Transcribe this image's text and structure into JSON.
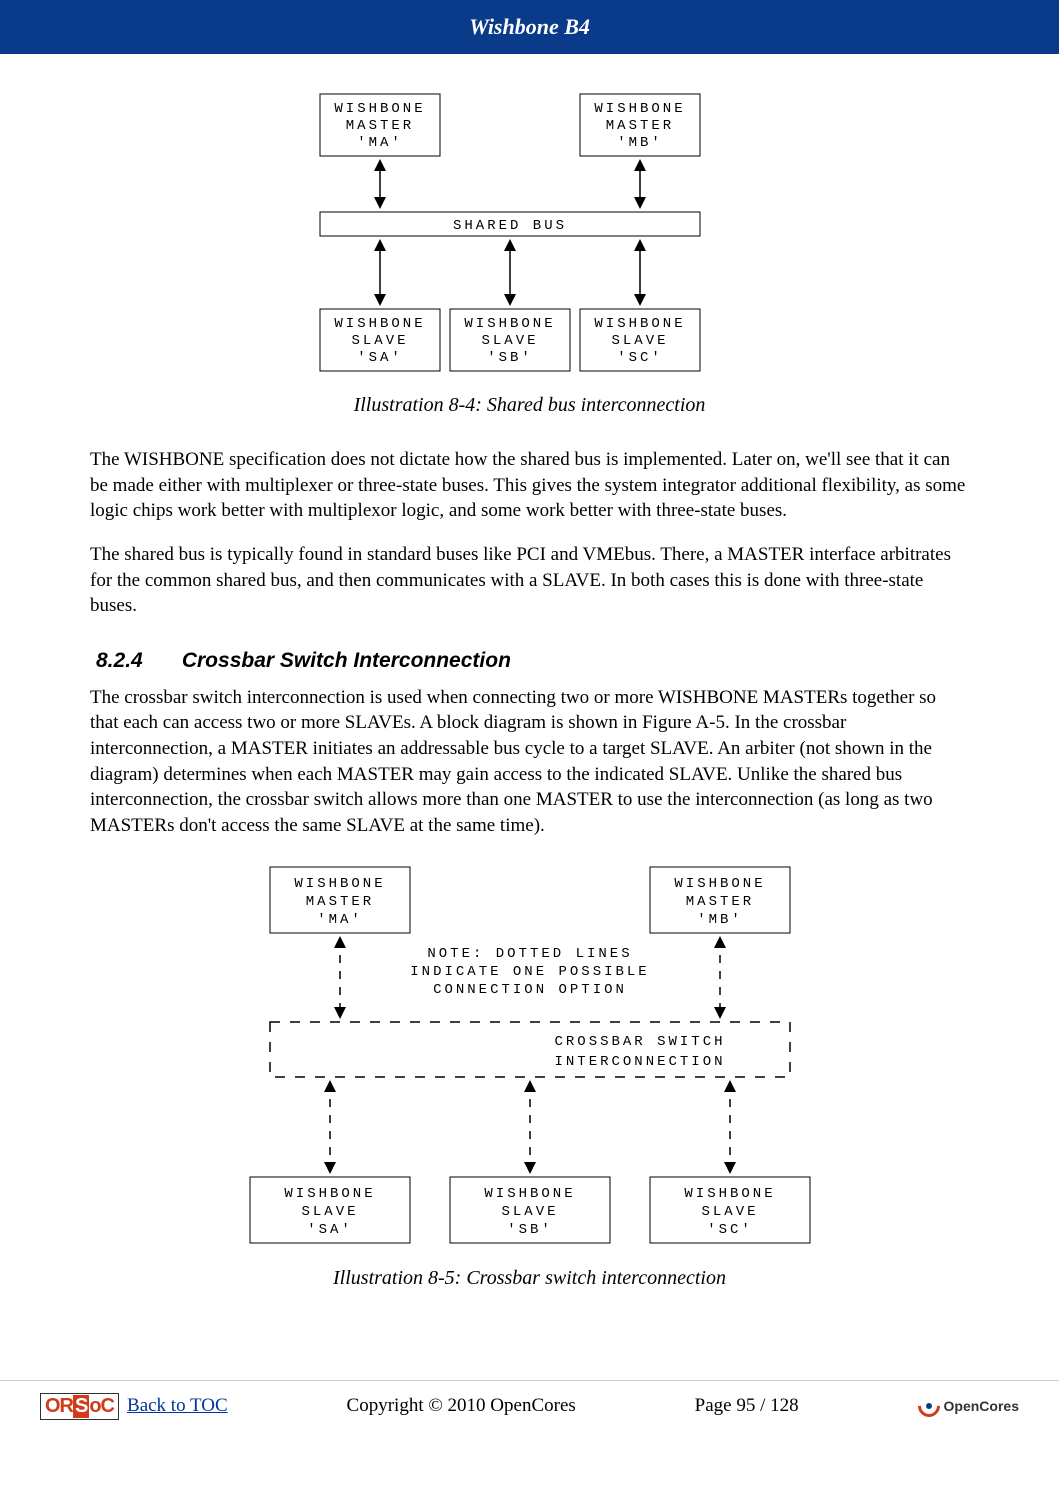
{
  "header": {
    "title": "Wishbone B4"
  },
  "fig1": {
    "master_a_l1": "WISHBONE",
    "master_a_l2": "MASTER",
    "master_a_l3": "'MA'",
    "master_b_l1": "WISHBONE",
    "master_b_l2": "MASTER",
    "master_b_l3": "'MB'",
    "shared_bus": "SHARED BUS",
    "slave_a_l1": "WISHBONE",
    "slave_a_l2": "SLAVE",
    "slave_a_l3": "'SA'",
    "slave_b_l1": "WISHBONE",
    "slave_b_l2": "SLAVE",
    "slave_b_l3": "'SB'",
    "slave_c_l1": "WISHBONE",
    "slave_c_l2": "SLAVE",
    "slave_c_l3": "'SC'",
    "caption": "Illustration 8-4: Shared bus interconnection"
  },
  "para1": "The WISHBONE specification does not dictate how the shared bus is implemented.  Later on, we'll see that it can be made either with multiplexer or three-state buses.  This gives the system integrator additional flexibility, as some logic chips work better with multiplexor logic, and some work better with three-state buses.",
  "para2": "The shared bus is typically found in standard buses like PCI and VMEbus.  There, a MASTER interface arbitrates for the common shared bus, and then communicates with a SLAVE.  In both cases this is done with three-state buses.",
  "section": {
    "num": "8.2.4",
    "title": "Crossbar Switch Interconnection"
  },
  "para3": "The crossbar switch interconnection is used when connecting two or more WISHBONE MASTERs together so that each can access two or more SLAVEs.  A block diagram is shown in Figure A-5.  In the crossbar interconnection, a MASTER initiates an addressable bus cycle to a target SLAVE.  An arbiter (not shown in the diagram) determines when each MASTER may gain access to the indicated SLAVE.  Unlike the shared bus interconnection, the crossbar switch allows more than one MASTER to use the interconnection (as long as two MASTERs don't access the same SLAVE at the same time).",
  "fig2": {
    "master_a_l1": "WISHBONE",
    "master_a_l2": "MASTER",
    "master_a_l3": "'MA'",
    "master_b_l1": "WISHBONE",
    "master_b_l2": "MASTER",
    "master_b_l3": "'MB'",
    "note_l1": "NOTE: DOTTED LINES",
    "note_l2": "INDICATE ONE POSSIBLE",
    "note_l3": "CONNECTION OPTION",
    "crossbar_l1": "CROSSBAR SWITCH",
    "crossbar_l2": "INTERCONNECTION",
    "slave_a_l1": "WISHBONE",
    "slave_a_l2": "SLAVE",
    "slave_a_l3": "'SA'",
    "slave_b_l1": "WISHBONE",
    "slave_b_l2": "SLAVE",
    "slave_b_l3": "'SB'",
    "slave_c_l1": "WISHBONE",
    "slave_c_l2": "SLAVE",
    "slave_c_l3": "'SC'",
    "caption": "Illustration 8-5: Crossbar switch interconnection"
  },
  "footer": {
    "toc": "Back to TOC",
    "copyright": "Copyright © 2010 OpenCores",
    "page": "Page 95 / 128",
    "opencores": "OpenCores"
  }
}
